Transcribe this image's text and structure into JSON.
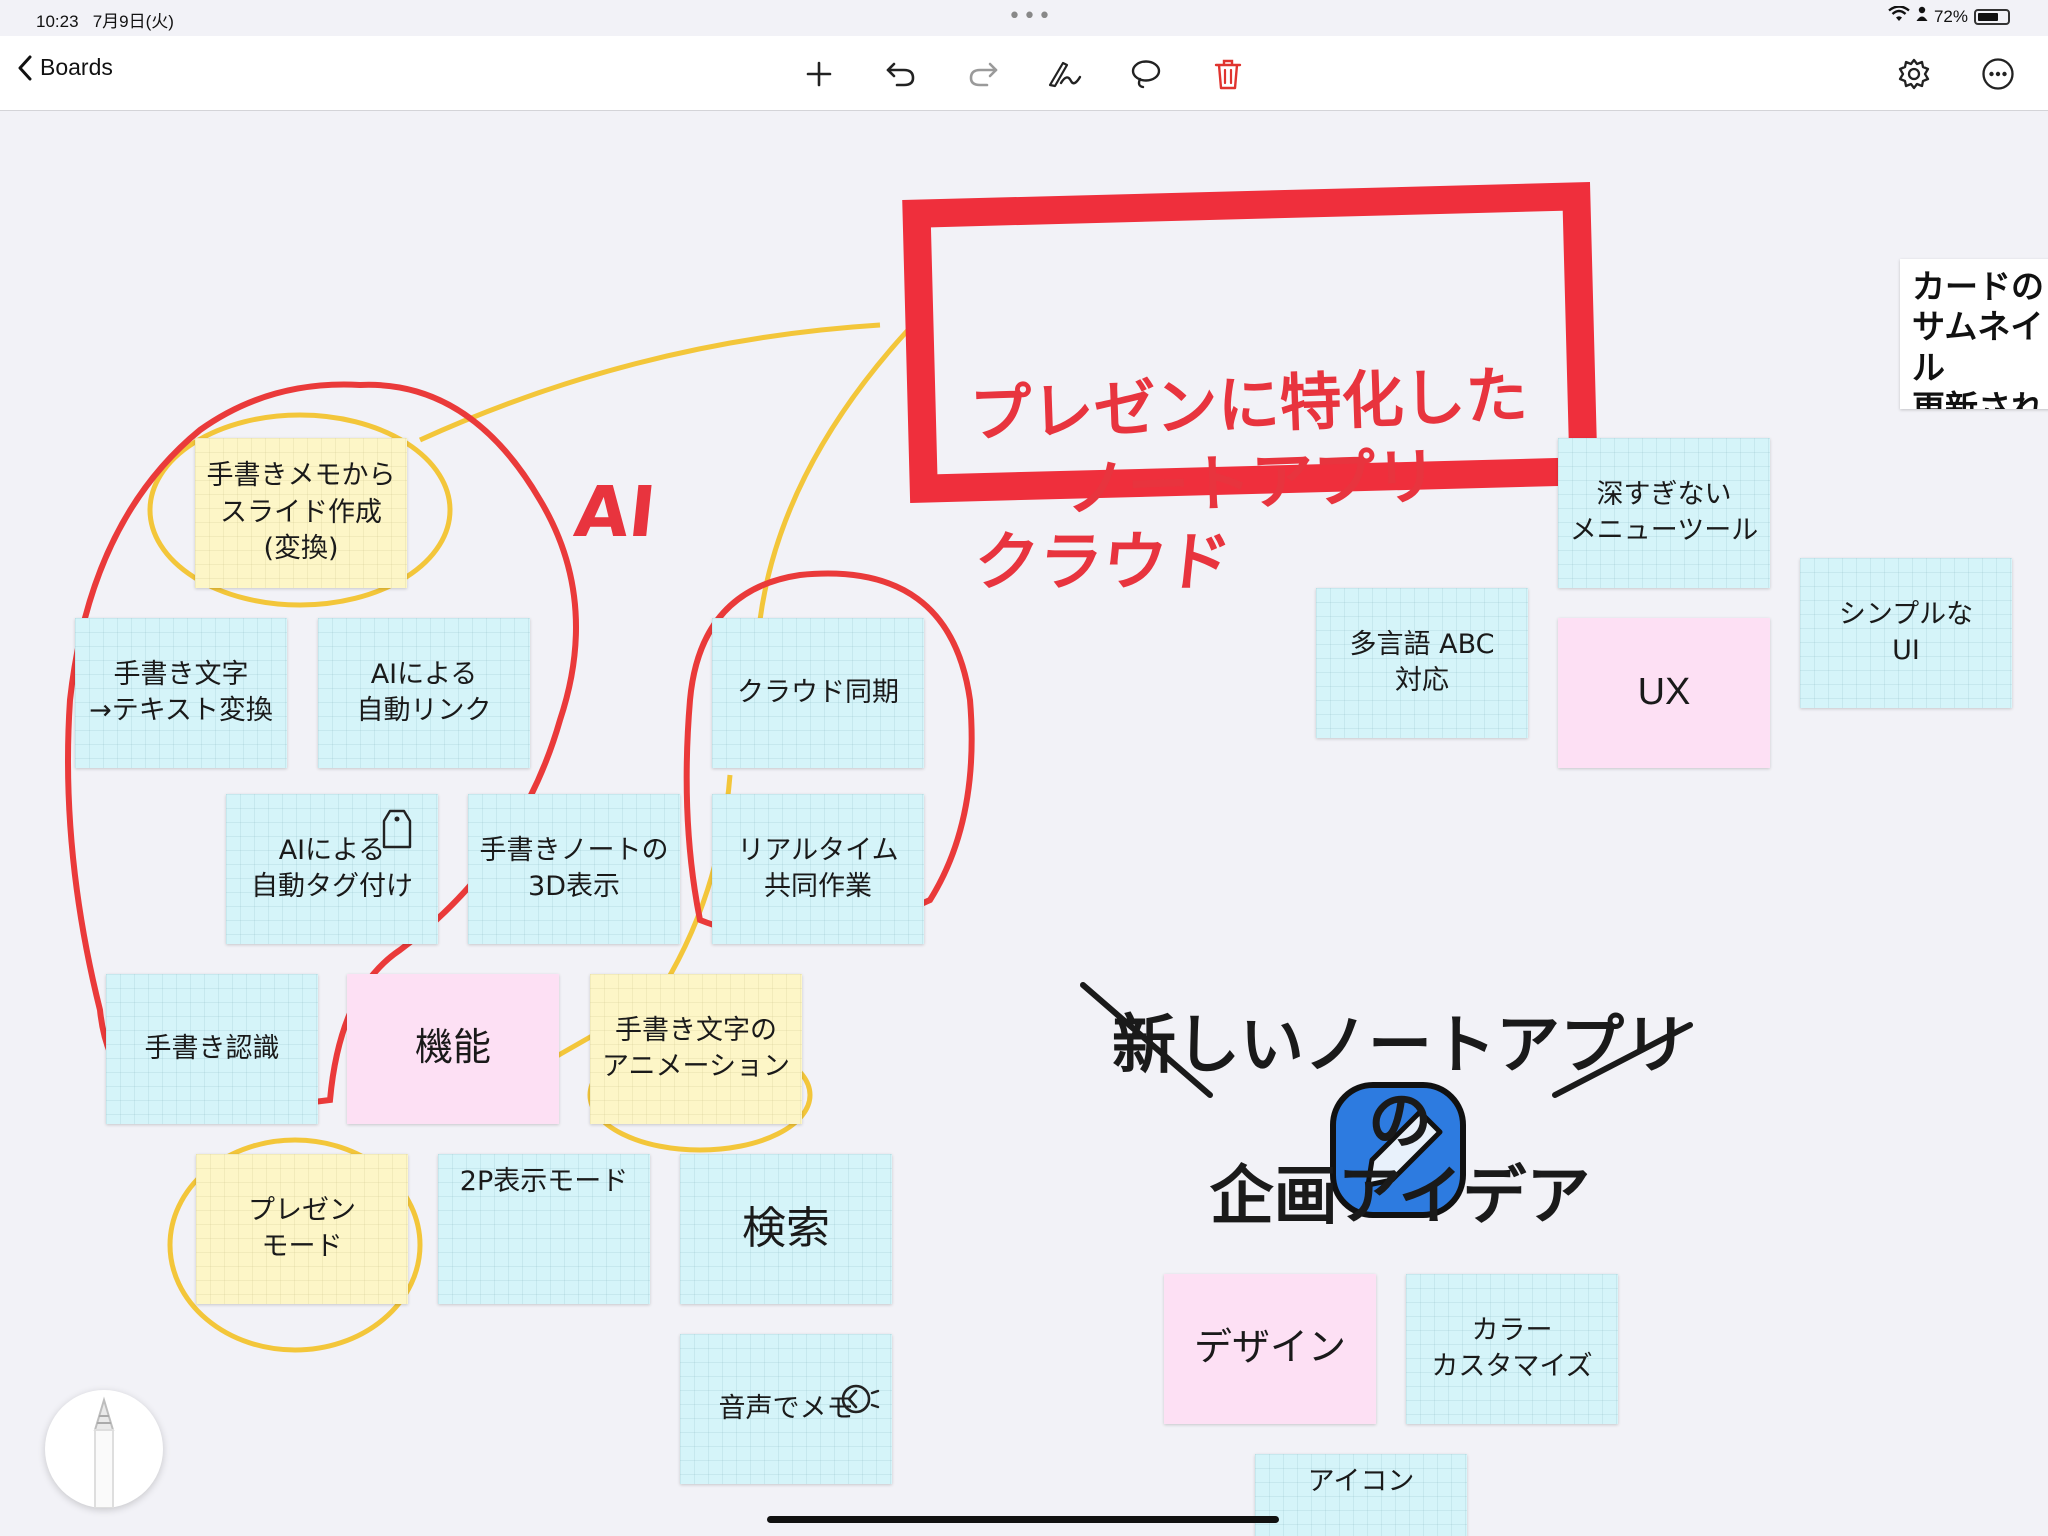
{
  "status": {
    "time": "10:23",
    "date": "7月9日(火)",
    "battery": "72%",
    "battery_level": 0.72
  },
  "toolbar": {
    "back_label": "Boards",
    "icons": [
      "plus-icon",
      "undo-icon",
      "redo-icon",
      "pen-icon",
      "lasso-icon",
      "trash-icon",
      "gear-icon",
      "more-icon"
    ]
  },
  "canvas": {
    "title_box": "プレゼンに特化した\nノートアプリ",
    "label_ai": "AI",
    "label_cloud": "クラウド",
    "heading": "新しいノートアプリの\n企画アイデア",
    "side_note": "カードの\nサムネイル\n更新され",
    "notes": [
      {
        "id": "n1",
        "text": "手書きメモから\nスライド作成\n(変換)"
      },
      {
        "id": "n2",
        "text": "手書き文字\n→テキスト変換"
      },
      {
        "id": "n3",
        "text": "AIによる\n自動リンク"
      },
      {
        "id": "n4",
        "text": "AIによる\n自動タグ付け"
      },
      {
        "id": "n5",
        "text": "手書きノートの\n3D表示"
      },
      {
        "id": "n6",
        "text": "手書き認識"
      },
      {
        "id": "n7",
        "text": "機能"
      },
      {
        "id": "n8",
        "text": "手書き文字の\nアニメーション"
      },
      {
        "id": "n9",
        "text": "プレゼン\nモード"
      },
      {
        "id": "n10",
        "text": "2P表示モード"
      },
      {
        "id": "n11",
        "text": "検索"
      },
      {
        "id": "n12",
        "text": "音声でメモ"
      },
      {
        "id": "n13",
        "text": "クラウド同期"
      },
      {
        "id": "n14",
        "text": "リアルタイム\n共同作業"
      },
      {
        "id": "n15",
        "text": "多言語 ABC\n対応"
      },
      {
        "id": "n16",
        "text": "深すぎない\nメニューツール"
      },
      {
        "id": "n17",
        "text": "UX"
      },
      {
        "id": "n18",
        "text": "シンプルな\nUI"
      },
      {
        "id": "n19",
        "text": "デザイン"
      },
      {
        "id": "n20",
        "text": "カラー\nカスタマイズ"
      },
      {
        "id": "n21",
        "text": "アイコン"
      }
    ]
  }
}
